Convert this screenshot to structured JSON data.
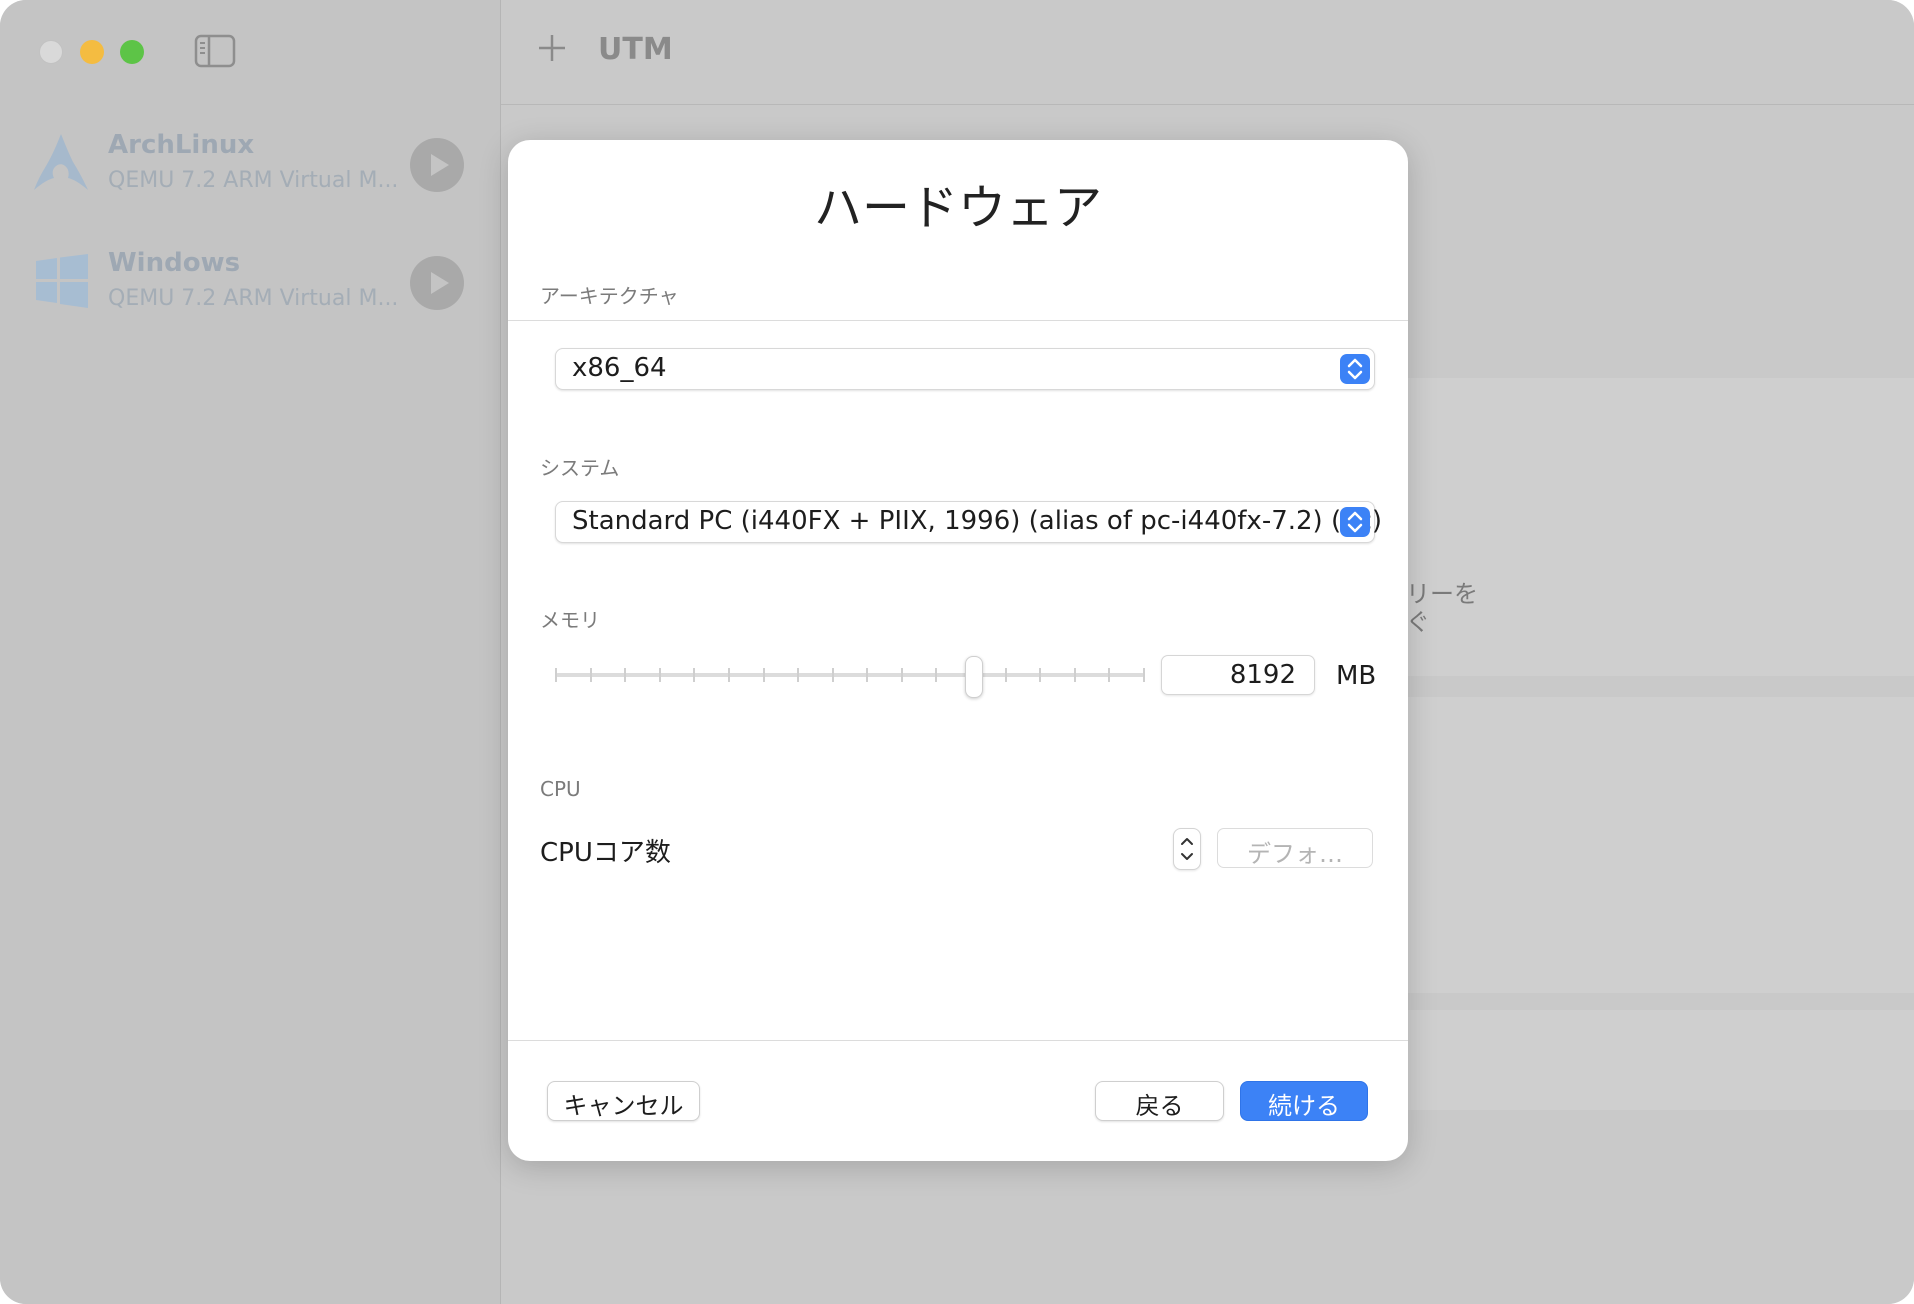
{
  "window": {
    "traffic_colors": {
      "close": "#d9d9d9",
      "minimize": "#f4bc41",
      "maximize": "#5dc447"
    }
  },
  "toolbar": {
    "add_icon": "plus-icon",
    "title": "UTM"
  },
  "sidebar": {
    "items": [
      {
        "name": "ArchLinux",
        "subtitle": "QEMU 7.2 ARM Virtual M...",
        "icon": "archlinux-logo"
      },
      {
        "name": "Windows",
        "subtitle": "QEMU 7.2 ARM Virtual M...",
        "icon": "windows-logo"
      }
    ]
  },
  "background": {
    "fragment1": "リーを",
    "fragment2": "ぐ"
  },
  "modal": {
    "title": "ハードウェア",
    "architecture": {
      "label": "アーキテクチャ",
      "value": "x86_64"
    },
    "system": {
      "label": "システム",
      "value": "Standard PC (i440FX + PIIX, 1996) (alias of pc-i440fx-7.2) (pc)"
    },
    "memory": {
      "label": "メモリ",
      "value": "8192",
      "unit": "MB",
      "slider_fraction": 0.71
    },
    "cpu": {
      "section_label": "CPU",
      "cores_label": "CPUコア数",
      "cores_placeholder": "デフォ…"
    },
    "buttons": {
      "cancel": "キャンセル",
      "back": "戻る",
      "continue": "続ける"
    },
    "accent_color": "#3c82f6"
  }
}
